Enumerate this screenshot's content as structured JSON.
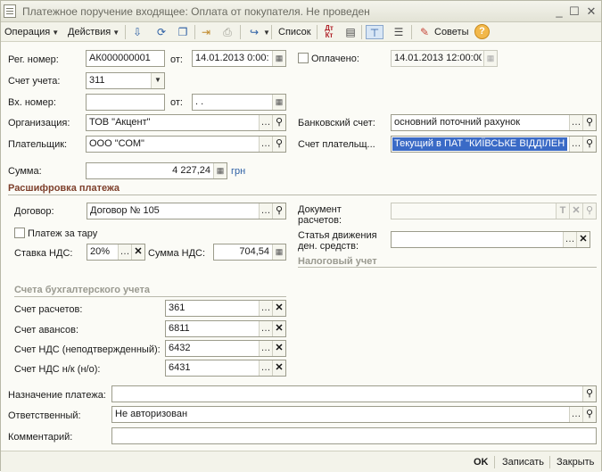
{
  "window": {
    "title": "Платежное поручение входящее: Оплата от покупателя. Не проведен",
    "minimize": "_",
    "maximize": "☐",
    "close": "✕"
  },
  "toolbar": {
    "operation_label": "Операция",
    "actions_label": "Действия",
    "list_label": "Список",
    "dt_kt_label": "Дт Кт",
    "tips_label": "Советы",
    "help_label": "?"
  },
  "header": {
    "reg_number_label": "Рег. номер:",
    "reg_number_value": "АК000000001",
    "from_label": "от:",
    "reg_date_value": "14.01.2013  0:00:",
    "paid_label": "Оплачено:",
    "paid_date_value": "14.01.2013 12:00:00",
    "account_label": "Счет учета:",
    "account_value": "311",
    "in_number_label": "Вх. номер:",
    "in_number_value": "",
    "in_date_label": "от:",
    "in_date_value": " .  .",
    "org_label": "Организация:",
    "org_value": "ТОВ \"Акцент\"",
    "bank_account_label": "Банковский счет:",
    "bank_account_value": "основний поточний рахунок",
    "payer_label": "Плательщик:",
    "payer_value": "ООО \"СОМ\"",
    "payer_account_label": "Счет плательщ...",
    "payer_account_value": "Текущий в ПАТ \"КИЇВСЬКЕ ВІДДІЛЕН",
    "sum_label": "Сумма:",
    "sum_value": "4 227,24",
    "currency": "грн"
  },
  "payment_details": {
    "section_title": "Расшифровка платежа",
    "contract_label": "Договор:",
    "contract_value": "Договор № 105",
    "settlement_doc_label": "Документ расчетов:",
    "settlement_doc_value": "",
    "container_label": "Платеж за тару",
    "cash_flow_label": "Статья движения ден. средств:",
    "cash_flow_value": "",
    "vat_rate_label": "Ставка НДС:",
    "vat_rate_value": "20%",
    "vat_sum_label": "Сумма НДС:",
    "vat_sum_value": "704,54",
    "tax_section_title": "Налоговый учет"
  },
  "accounting": {
    "section_title": "Счета бухгалтерского учета",
    "rows": [
      {
        "label": "Счет расчетов:",
        "value": "361"
      },
      {
        "label": "Счет авансов:",
        "value": "6811"
      },
      {
        "label": "Счет НДС (неподтвержденный):",
        "value": "6432"
      },
      {
        "label": "Счет НДС н/к (н/о):",
        "value": "6431"
      }
    ]
  },
  "footer_fields": {
    "purpose_label": "Назначение платежа:",
    "purpose_value": "",
    "responsible_label": "Ответственный:",
    "responsible_value": "Не авторизован",
    "comment_label": "Комментарий:",
    "comment_value": ""
  },
  "bottom": {
    "ok_label": "OK",
    "save_label": "Записать",
    "close_label": "Закрыть"
  }
}
